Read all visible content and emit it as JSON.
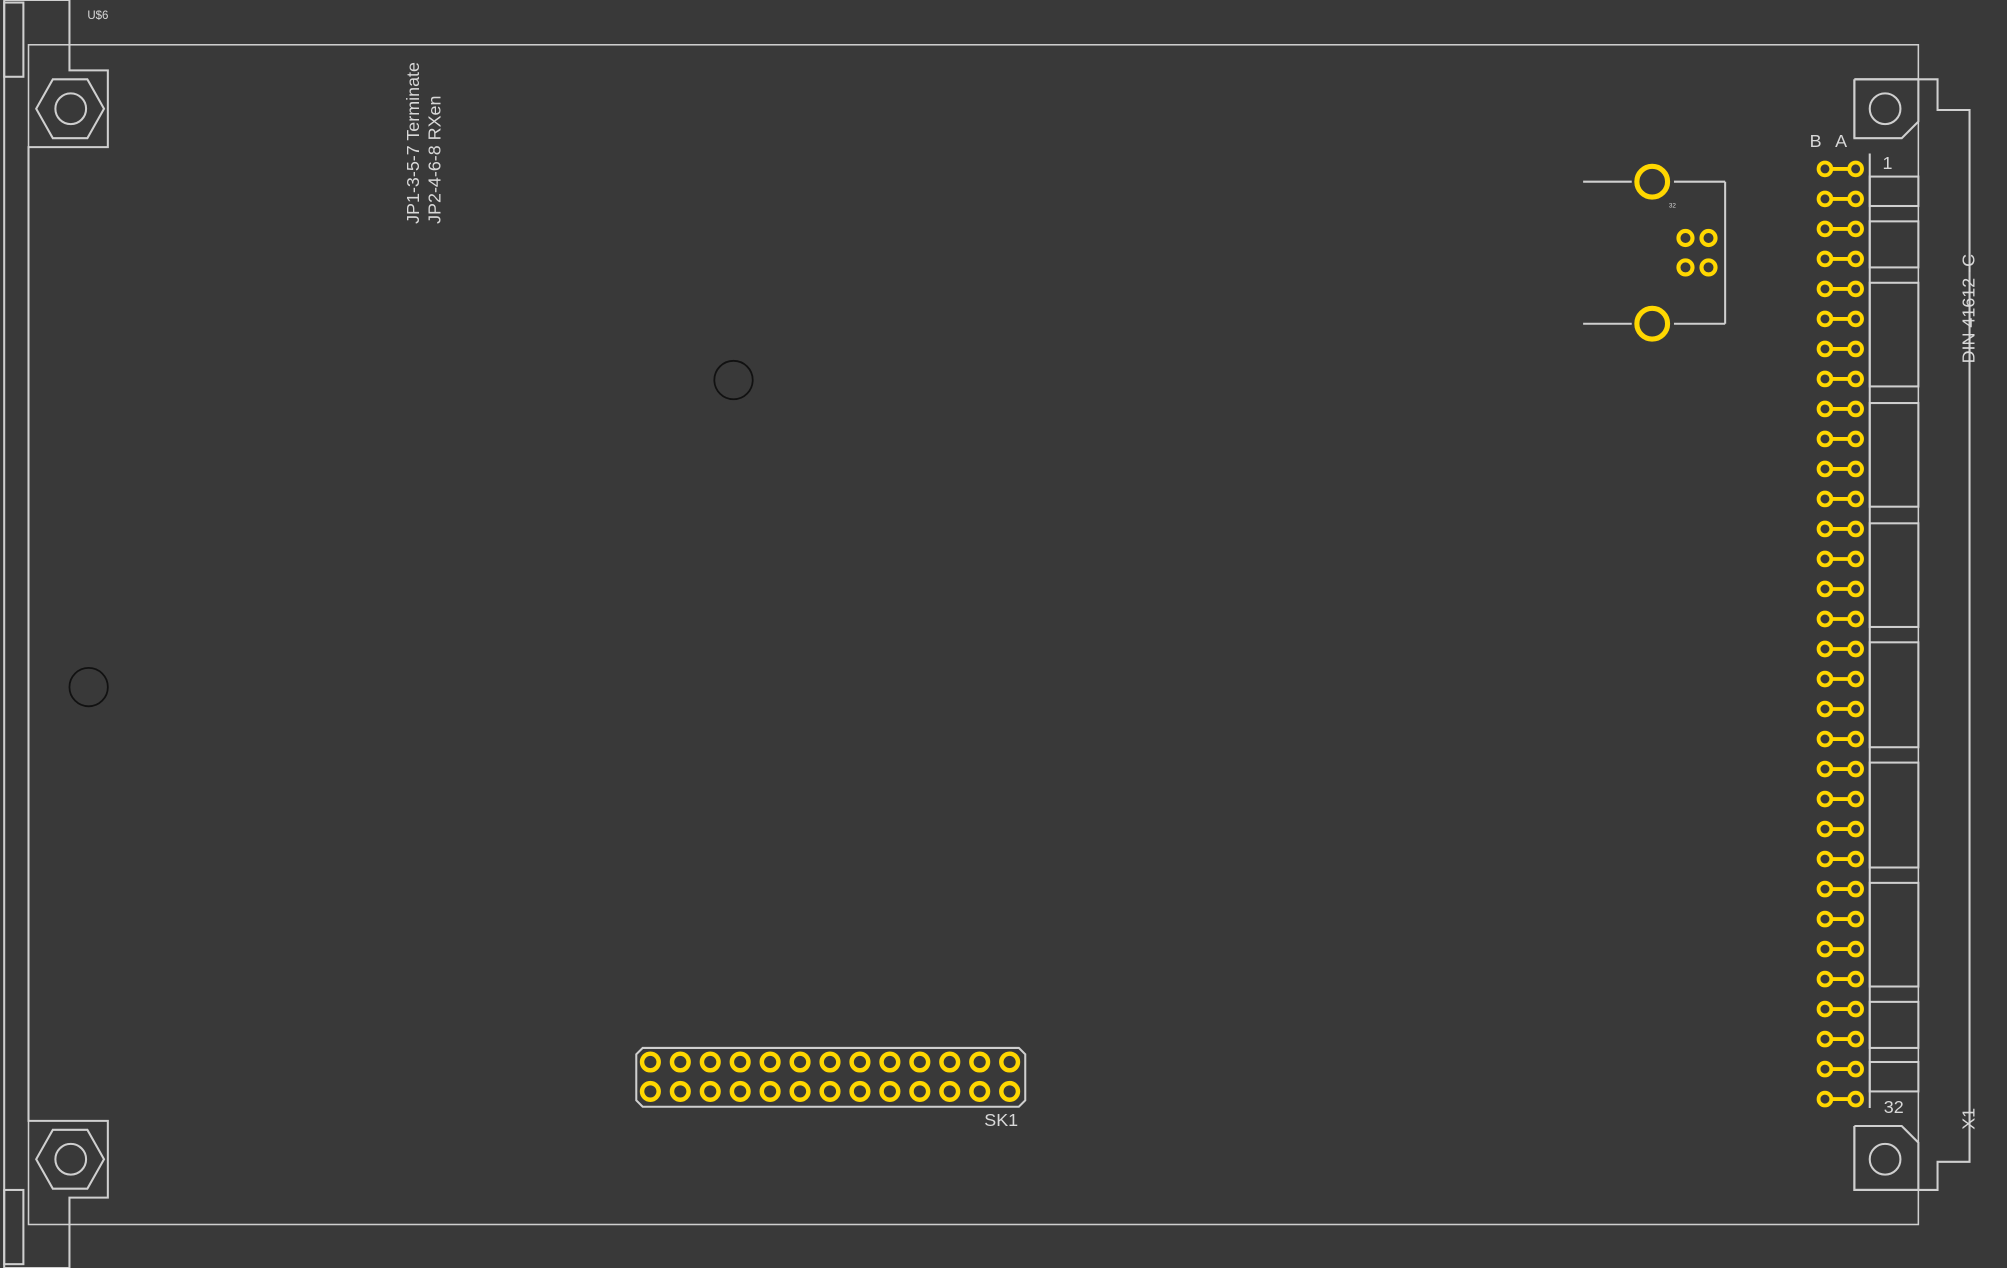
{
  "labels": {
    "board_ref": "U$6",
    "jumper_line1": "JP1-3-5-7 Terminate",
    "jumper_line2": "JP2-4-6-8 RXen",
    "connector_title": "DIN 41612 -C",
    "connector_ref": "X1",
    "pin_first": "1",
    "pin_last": "32",
    "row_b": "B",
    "row_a": "A",
    "header_ref": "SK1",
    "jack_mark": "32"
  },
  "colors": {
    "background": "#393939",
    "silkscreen": "#cfcfcf",
    "pad_copper": "#e8c200",
    "pad_ring": "#ffd700"
  },
  "sk1": {
    "rows": 2,
    "columns": 13
  },
  "din_connector": {
    "rows": [
      "B",
      "A"
    ],
    "pins_per_row": 32
  },
  "rj_jack": {
    "mounting_holes": 2,
    "signal_pads": 4
  }
}
